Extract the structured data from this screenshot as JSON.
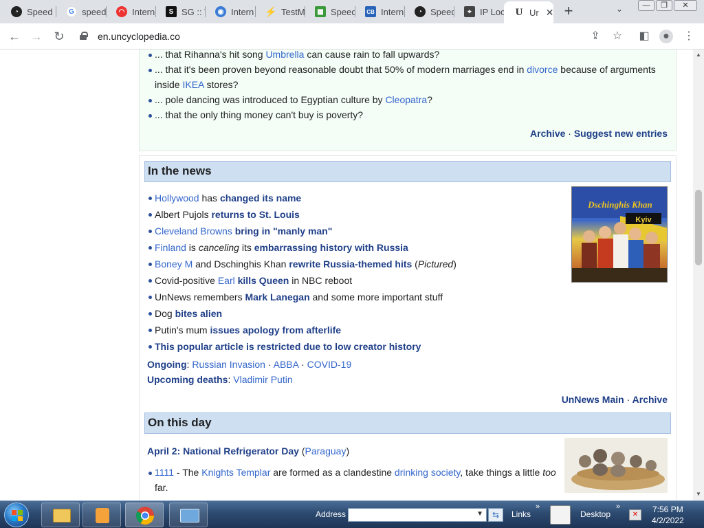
{
  "browser": {
    "tabs": [
      {
        "label": "Speed",
        "color": "#222"
      },
      {
        "label": "speed",
        "color": "#4285f4"
      },
      {
        "label": "Intern",
        "color": "#e33"
      },
      {
        "label": "SG :: V",
        "color": "#111"
      },
      {
        "label": "Intern",
        "color": "#3a7bd5"
      },
      {
        "label": "TestM",
        "color": "#333"
      },
      {
        "label": "Speed",
        "color": "#3c9a3c"
      },
      {
        "label": "Intern",
        "color": "#2a64b8"
      },
      {
        "label": "Speed",
        "color": "#222"
      },
      {
        "label": "IP Loc",
        "color": "#444"
      },
      {
        "label": "Ur",
        "color": "#555"
      }
    ],
    "new_tab": "+",
    "url": "en.uncyclopedia.co"
  },
  "dyk": {
    "items": [
      {
        "a": "... that Rihanna's hit song ",
        "b": "Umbrella",
        "c": " can cause rain to fall upwards?"
      },
      {
        "a": "... that it's been proven beyond reasonable doubt that 50% of modern marriages end in ",
        "b": "divorce",
        "c": " because of arguments inside ",
        "d": "IKEA",
        "e": " stores?"
      },
      {
        "a": "... pole dancing was introduced to Egyptian culture by ",
        "b": "Cleopatra",
        "c": "?"
      },
      {
        "a": "... that the only thing money can't buy is poverty?"
      }
    ],
    "archive": "Archive",
    "sep": "·",
    "suggest": "Suggest new entries"
  },
  "news": {
    "title": "In the news",
    "items": [
      {
        "l1": "Hollywood",
        "t1": " has ",
        "b1": "changed its name"
      },
      {
        "t1": "Albert Pujols ",
        "b1": "returns to St. Louis"
      },
      {
        "l1": "Cleveland Browns",
        "t1": " ",
        "b1": "bring in \"manly man\""
      },
      {
        "l1": "Finland",
        "t1": " is ",
        "i1": "canceling",
        "t2": " its ",
        "b1": "embarrassing history with Russia"
      },
      {
        "l1": "Boney M",
        "t1": " and Dschinghis Khan ",
        "b1": "rewrite Russia-themed hits",
        "t2": " (",
        "i1": "Pictured",
        "t3": ")"
      },
      {
        "t1": "Covid-positive ",
        "l1": "Earl",
        "t2": " ",
        "b1": "kills Queen",
        "t3": " in NBC reboot"
      },
      {
        "t1": "UnNews remembers ",
        "b1": "Mark Lanegan",
        "t2": " and some more important stuff"
      },
      {
        "t1": "Dog ",
        "b1": "bites alien"
      },
      {
        "t1": "Putin's mum ",
        "b1": "issues apology from afterlife"
      },
      {
        "b1": "This popular article is restricted due to low creator history"
      }
    ],
    "ongoing_label": "Ongoing",
    "ongoing": [
      "Russian Invasion",
      "ABBA",
      "COVID-19"
    ],
    "upcoming_label": "Upcoming deaths",
    "upcoming": "Vladimir Putin",
    "main": "UnNews Main",
    "archive": "Archive",
    "image_text": {
      "top": "Dschinghis Khan",
      "sign": "Kyiv"
    }
  },
  "onthisday": {
    "title": "On this day",
    "date": "April 2:",
    "event": "National Refrigerator Day",
    "place": "Paraguay",
    "item1": {
      "year": "1111",
      "t1": " - The ",
      "l1": "Knights Templar",
      "t2": " are formed as a clandestine ",
      "l2": "drinking society",
      "t3": ", take things a little ",
      "i1": "too",
      "t4": " far."
    }
  },
  "taskbar": {
    "address_label": "Address",
    "links_label": "Links",
    "desktop_label": "Desktop",
    "time": "7:56 PM",
    "date": "4/2/2022"
  }
}
